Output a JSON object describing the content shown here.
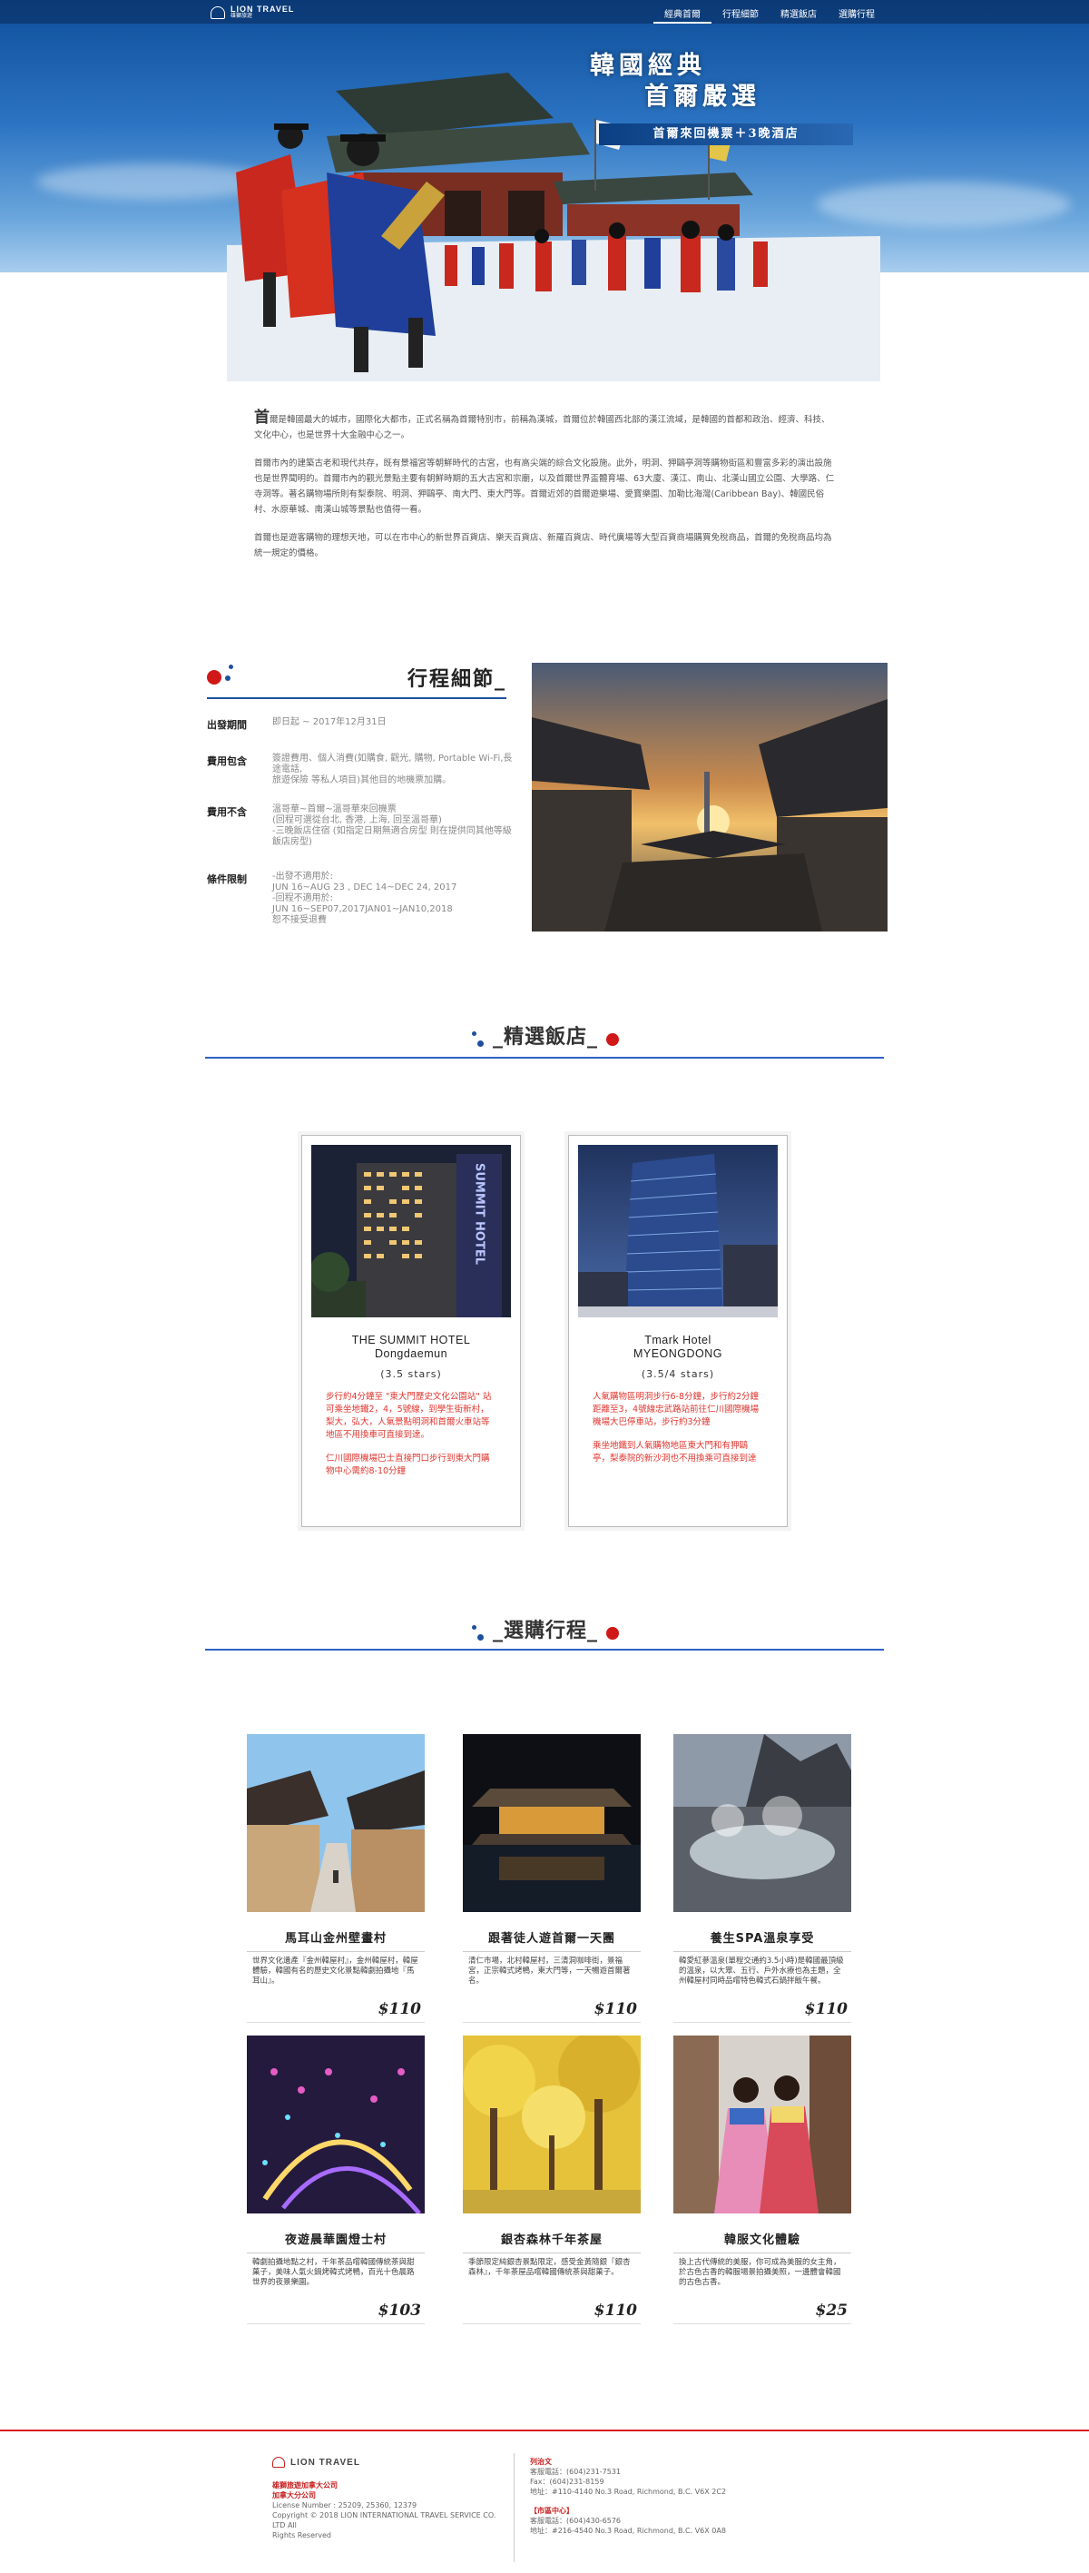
{
  "brand": {
    "logo_text": "LION TRAVEL",
    "logo_sub": "雄獅旅遊"
  },
  "nav": {
    "items": [
      "經典首爾",
      "行程細節",
      "精選飯店",
      "選購行程"
    ],
    "active_index": 0
  },
  "hero": {
    "title_line1": "韓國經典",
    "title_line2": "首爾嚴選",
    "subtitle": "首爾來回機票＋3晚酒店"
  },
  "intro": {
    "dropcap": "首",
    "paragraphs": [
      "爾是韓國最大的城市，國際化大都市，正式名稱為首爾特別市，前稱為漢城，首爾位於韓國西北部的漢江流域，是韓國的首都和政治、經濟、科技、文化中心，也是世界十大金融中心之一。",
      "首爾市內的建築古老和現代共存，既有景福宮等朝鮮時代的古宮，也有高尖端的綜合文化設施。此外，明洞、狎鷗亭洞等購物街區和豐富多彩的演出設施也是世界聞明的。首爾市內的觀光景點主要有朝鮮時期的五大古宮和宗廟，以及首爾世界盃體育場、63大廈、漢江、南山、北漢山國立公園、大學路、仁寺洞等。著名購物場所則有梨泰院、明洞、狎鷗亭、南大門、東大門等。首爾近郊的首爾遊樂場、愛寶樂園、加勒比海灣(Caribbean Bay)、韓國民俗村、水原華城、南漢山城等景點也值得一看。",
      "首爾也是遊客購物的理想天地，可以在市中心的新世界百貨店、樂天百貨店、新羅百貨店、時代廣場等大型百貨商場購買免稅商品，首爾的免稅商品均為統一規定的價格。"
    ]
  },
  "itinerary": {
    "title": "行程細節_",
    "rows": [
      {
        "label": "出發期間",
        "value": "即日起 ~ 2017年12月31日"
      },
      {
        "label": "費用包含",
        "value": "簽證費用、個人消費(如購食, 觀光, 購物, Portable Wi-Fi,長途電話,\n旅遊保險 等私人項目)其他目的地機票加購。"
      },
      {
        "label": "費用不含",
        "value": "溫哥華~首爾~溫哥華來回機票\n(回程可選從台北, 香港, 上海, 回至溫哥華)\n-三晚飯店住宿 (如指定日期無適合房型 則在提供同其他等級飯店房型)"
      },
      {
        "label": "條件限制",
        "value": "-出發不適用於:\nJUN 16~AUG 23 , DEC 14~DEC 24, 2017\n-回程不適用於:\nJUN 16~SEP07,2017JAN01~JAN10,2018\n恕不接受退費"
      }
    ]
  },
  "hotels_section": {
    "title": "_精選飯店_"
  },
  "hotels": [
    {
      "name": "THE SUMMIT HOTEL\nDongdaemun",
      "stars": "(3.5 stars)",
      "desc": [
        "步行約4分鐘至 \"東大門歷史文化公園站\" 站可乘坐地鐵2，4，5號線，到學生街新村，梨大，弘大，人氣景點明洞和首爾火車站等地區不用換車可直接到達。",
        "仁川國際機場巴士直接門口步行到東大門購物中心需約8-10分鐘"
      ],
      "sign": "SUMMIT HOTEL"
    },
    {
      "name": "Tmark Hotel\nMYEONGDONG",
      "stars": "(3.5/4 stars)",
      "desc": [
        "人氣購物區明洞步行6-8分鐘，步行約2分鐘距離至3，4號線忠武路站前往仁川國際機場機場大巴停車站，步行約3分鐘",
        "乘坐地鐵到人氣購物地區東大門和有狎鷗亭，梨泰院的新沙洞也不用換乘可直接到達"
      ]
    }
  ],
  "tours_section": {
    "title": "_選購行程_"
  },
  "tours": [
    {
      "title": "馬耳山金州壁畫村",
      "desc": "世界文化遺產『金州韓屋村』，金州韓屋村，韓屋體驗，韓國有名的歷史文化景點韓劇拍攝地『馬耳山』。",
      "price": "$110"
    },
    {
      "title": "跟著徒人遊首爾一天團",
      "desc": "清仁市場，北村韓屋村，三清洞咖啡街，景福宮，正宗韓式烤鴨，東大門等，一天暢遊首爾著名。",
      "price": "$110"
    },
    {
      "title": "養生SPA溫泉享受",
      "desc": "韓愛紅蔘溫泉(單程交通約3.5小時)是韓國最頂級的溫泉，以大眾、五行、戶外水療也為主題，全州韓屋村同時品嚐特色韓式石鍋拌飯午餐。",
      "price": "$110"
    },
    {
      "title": "夜遊晨華園燈士村",
      "desc": "韓劇拍攝地點之村，千年茶品嚐韓國傳統茶與甜菓子，美味人氣火鍋烤韓式烤鴨，百光十色晨路世界的夜景樂園。",
      "price": "$103"
    },
    {
      "title": "銀杏森林千年茶屋",
      "desc": "季節限定純銀杏景點限定，感受金黃隨銀『銀杏森林』，千年茶屋品嚐韓國傳統茶與甜菓子。",
      "price": "$110"
    },
    {
      "title": "韓服文化體驗",
      "desc": "換上古代傳統的美服，你可成為美服的女主角，於古色古香的韓服場景拍攝美照，一邊體會韓國的古色古香。",
      "price": "$25"
    }
  ],
  "footer": {
    "logo_text": "LION TRAVEL",
    "left_lines": [
      {
        "text": "雄獅旅遊加拿大公司",
        "red": true
      },
      {
        "text": "加拿大分公司",
        "red": true
      },
      {
        "text": "License Number : 25209, 25360, 12379",
        "red": false
      },
      {
        "text": "Copyright © 2018 LION INTERNATIONAL TRAVEL SERVICE CO. LTD All",
        "red": false
      },
      {
        "text": "Rights Reserved",
        "red": false
      }
    ],
    "right_blocks": [
      {
        "heading": "列治文",
        "lines": [
          "客服電話：(604)231-7531",
          "Fax：(604)231-8159",
          "地址：#110-4140 No.3 Road, Richmond, B.C. V6X 2C2"
        ]
      },
      {
        "heading": "【市區中心】",
        "lines": [
          "客服電話：(604)430-6576",
          "地址：#216-4540 No.3 Road, Richmond, B.C. V6X 0A8"
        ]
      }
    ]
  },
  "colors": {
    "accent_blue": "#1d4f9c",
    "accent_red": "#d01818",
    "hotel_text": "#e0352e"
  }
}
